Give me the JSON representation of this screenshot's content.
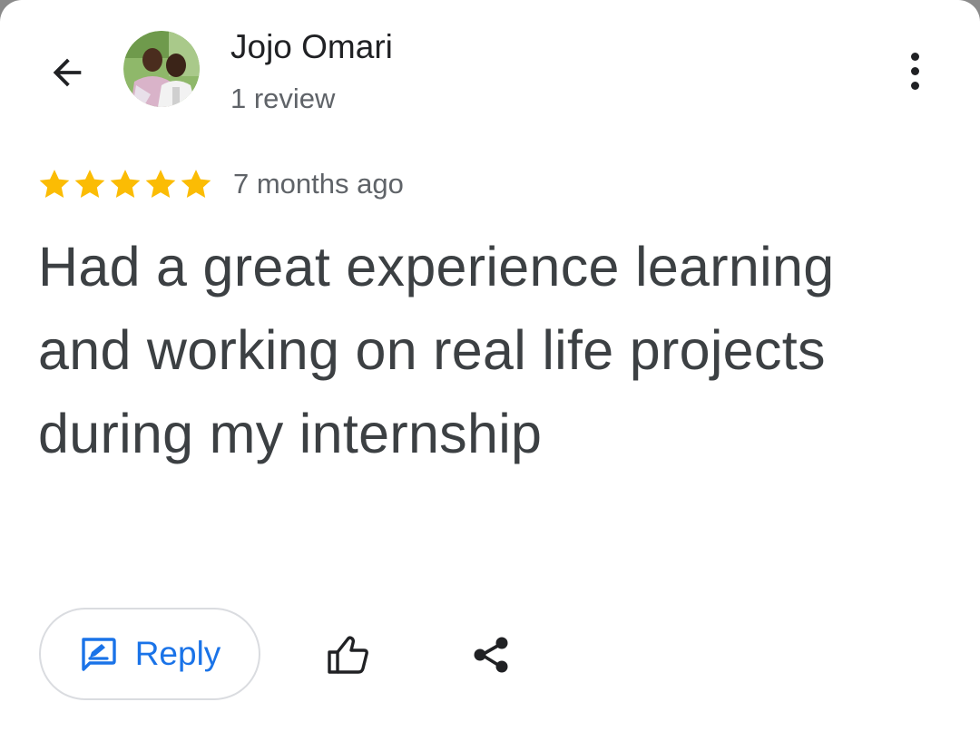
{
  "header": {
    "back_icon": "arrow-back-icon",
    "avatar_icon": "profile-photo",
    "author_name": "Jojo Omari",
    "review_count": "1 review",
    "more_icon": "more-vert-icon"
  },
  "review": {
    "rating": 5,
    "rating_max": 5,
    "star_color": "#fbbc04",
    "time_ago": "7 months ago",
    "text": "Had a great experience learning and working on real life projects during my internship"
  },
  "actions": {
    "reply_label": "Reply",
    "reply_icon": "reply-edit-icon",
    "like_icon": "thumb-up-icon",
    "share_icon": "share-icon",
    "accent_color": "#1a73e8"
  }
}
